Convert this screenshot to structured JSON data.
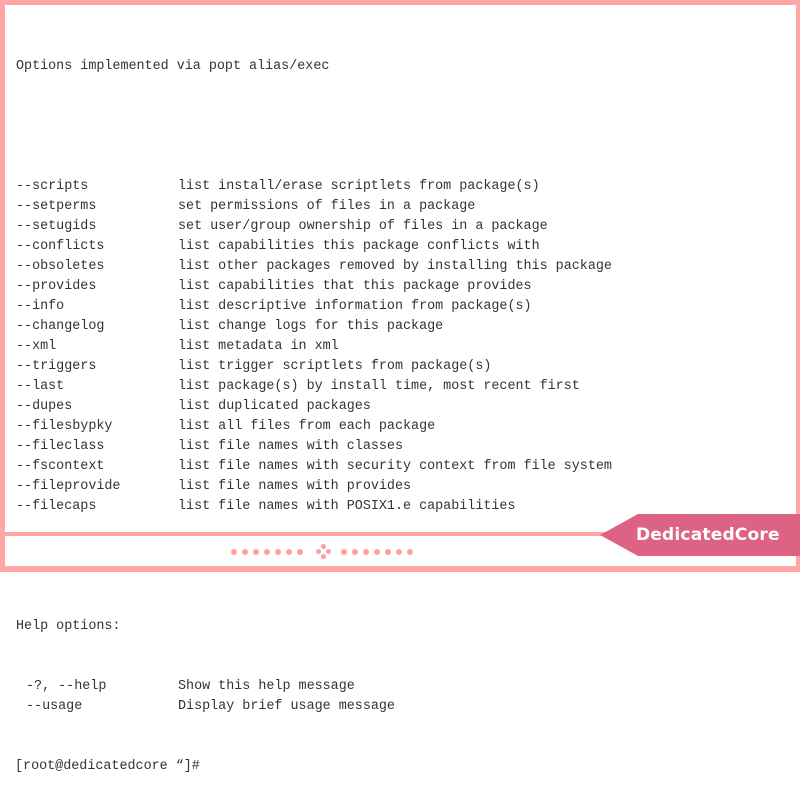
{
  "terminal": {
    "heading": "Options implemented via popt alias/exec",
    "options": [
      {
        "flag": "--scripts",
        "description": "list install/erase scriptlets from package(s)"
      },
      {
        "flag": "--setperms",
        "description": "set permissions of files in a package"
      },
      {
        "flag": "--setugids",
        "description": "set user/group ownership of files in a package"
      },
      {
        "flag": "--conflicts",
        "description": "list capabilities this package conflicts with"
      },
      {
        "flag": "--obsoletes",
        "description": "list other packages removed by installing this package"
      },
      {
        "flag": "--provides",
        "description": "list capabilities that this package provides"
      },
      {
        "flag": "--info",
        "description": "list descriptive information from package(s)"
      },
      {
        "flag": "--changelog",
        "description": "list change logs for this package"
      },
      {
        "flag": "--xml",
        "description": "list metadata in xml"
      },
      {
        "flag": "--triggers",
        "description": "list trigger scriptlets from package(s)"
      },
      {
        "flag": "--last",
        "description": "list package(s) by install time, most recent first"
      },
      {
        "flag": "--dupes",
        "description": "list duplicated packages"
      },
      {
        "flag": "--filesbypky",
        "description": "list all files from each package"
      },
      {
        "flag": "--fileclass",
        "description": "list file names with classes"
      },
      {
        "flag": "--fscontext",
        "description": "list file names with security context from file system"
      },
      {
        "flag": "--fileprovide",
        "description": "list file names with provides"
      },
      {
        "flag": "--filecaps",
        "description": "list file names with POSIX1.e capabilities"
      }
    ],
    "help_heading": "Help options:",
    "help_options": [
      {
        "flag": "-?, --help",
        "description": "Show this help message"
      },
      {
        "flag": "--usage",
        "description": "Display brief usage message"
      }
    ],
    "prompt": "[root@dedicatedcore “]#"
  },
  "branding": {
    "badge_label": "DedicatedCore",
    "badge_color": "#dc6383",
    "frame_color": "#ffa6a6"
  }
}
